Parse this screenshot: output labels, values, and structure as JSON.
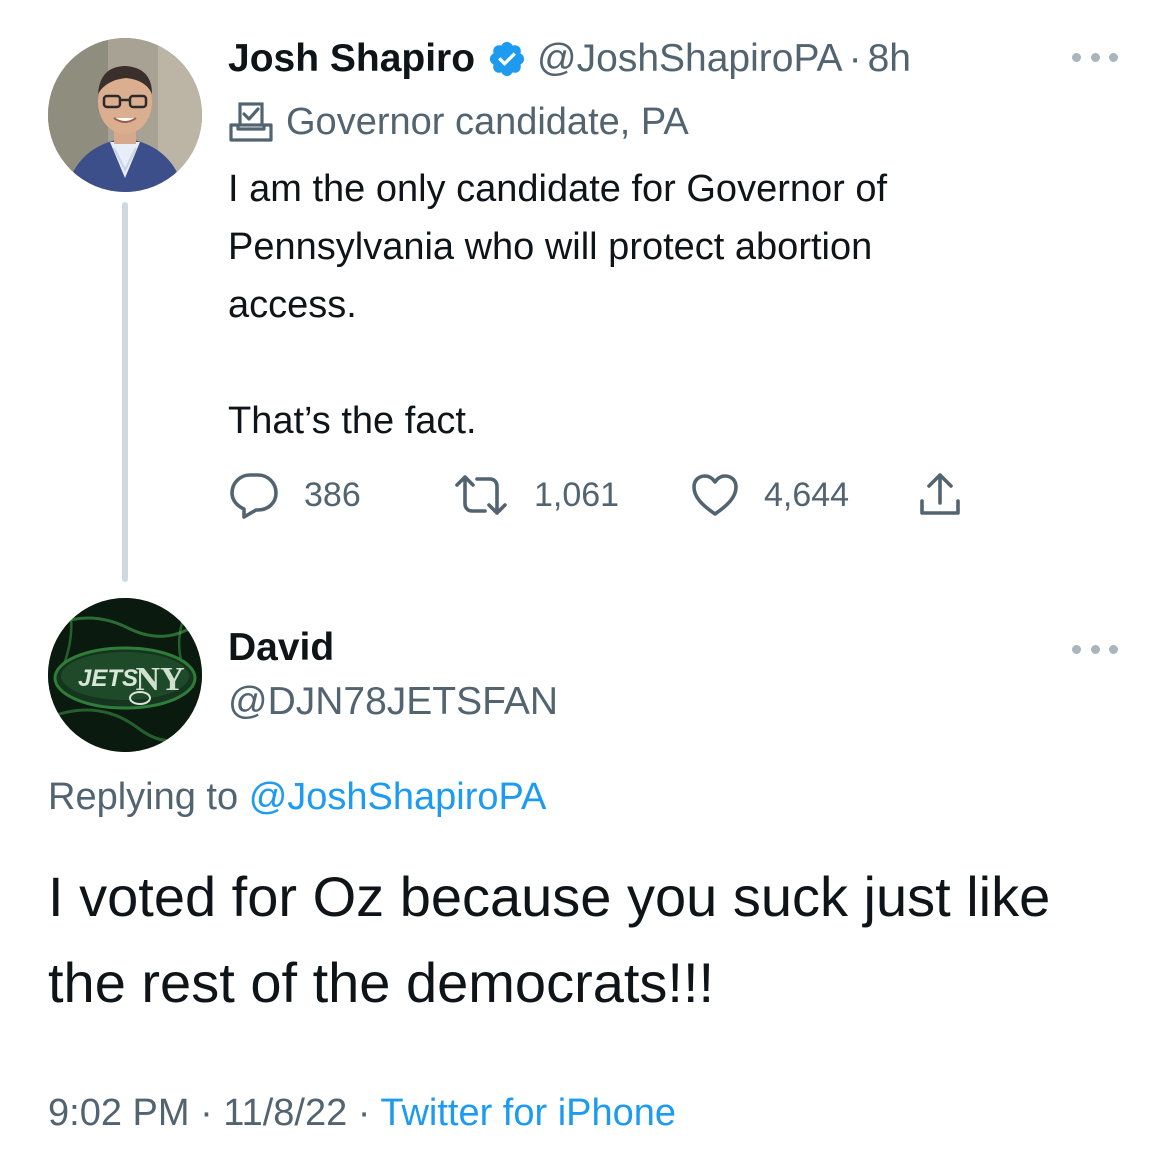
{
  "parent_tweet": {
    "display_name": "Josh Shapiro",
    "handle": "@JoshShapiroPA",
    "separator": "·",
    "time": "8h",
    "label": "Governor candidate, PA",
    "text_lines": [
      "I am the only candidate for Governor of",
      "Pennsylvania who will protect abortion",
      "access."
    ],
    "text_line_2": "That’s the fact.",
    "actions": {
      "replies": "386",
      "retweets": "1,061",
      "likes": "4,644"
    },
    "icons": {
      "verified": "verified-badge-icon",
      "label": "ballot-box-icon",
      "reply": "reply-icon",
      "retweet": "retweet-icon",
      "like": "heart-icon",
      "share": "share-icon",
      "more": "more-icon"
    }
  },
  "reply_tweet": {
    "display_name": "David",
    "handle": "@DJN78JETSFAN",
    "replying_prefix": "Replying to",
    "replying_handle": "@JoshShapiroPA",
    "text": "I voted for Oz because you suck just like the rest of the democrats!!!",
    "timestamp": "9:02 PM · 11/8/22 ·",
    "source": "Twitter for iPhone"
  },
  "colors": {
    "text_primary": "#0f1419",
    "text_secondary": "#536471",
    "link": "#1d9bf0",
    "thread_line": "#cfd9de",
    "more_dots": "#a9b4bc",
    "avatar2_accent": "#2f7d3a"
  }
}
